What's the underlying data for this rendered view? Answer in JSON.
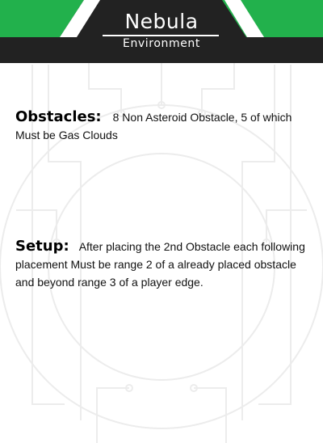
{
  "card": {
    "title": "Nebula",
    "subtitle": "Environment",
    "colors": {
      "accent": "#22b14c",
      "header": "#222222",
      "background": "#ffffff",
      "watermark": "#eeeeee"
    }
  },
  "sections": {
    "obstacles": {
      "label": "Obstacles:",
      "text": "8 Non Asteroid Obstacle, 5 of which Must be Gas Clouds"
    },
    "setup": {
      "label": "Setup:",
      "text": "After placing the 2nd Obstacle each following placement Must be range 2 of a already placed obstacle and beyond range 3 of a player edge."
    }
  }
}
